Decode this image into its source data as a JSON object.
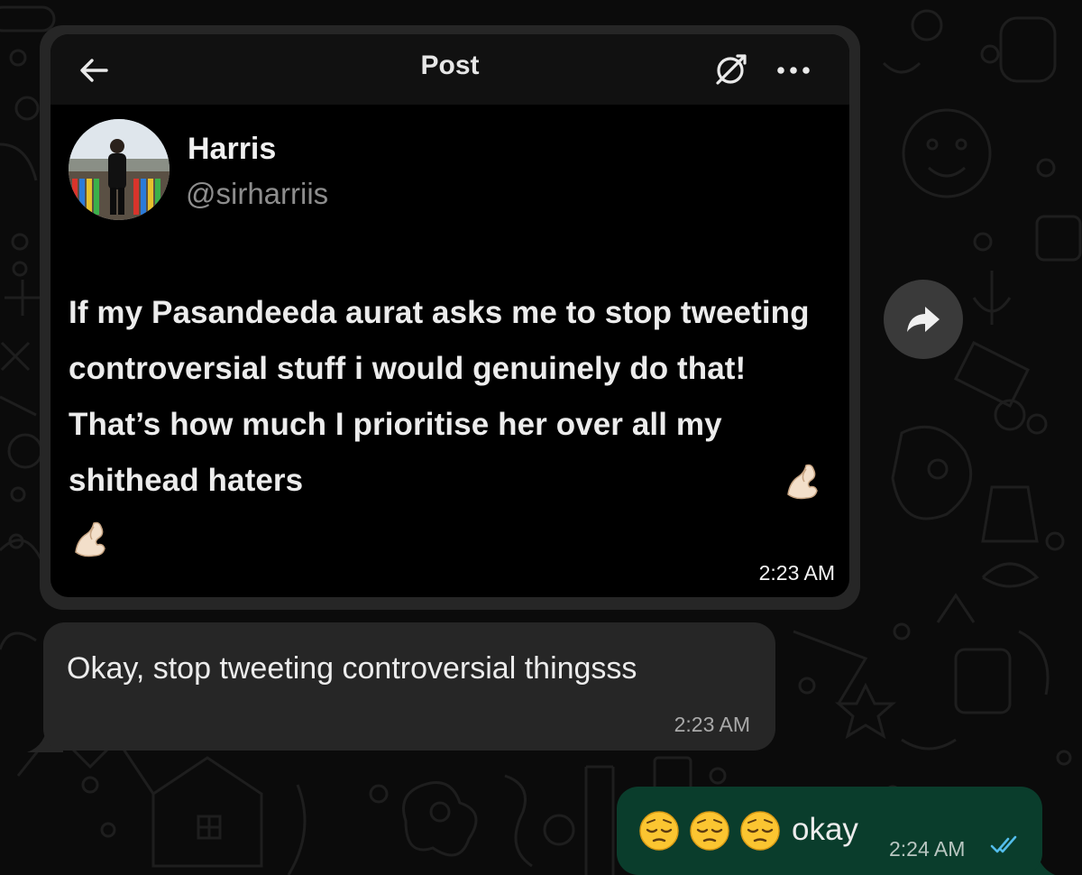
{
  "post": {
    "header_title": "Post",
    "back_icon": "arrow-left-icon",
    "noop_icon": "no-entry-slash-icon",
    "more_icon": "ellipsis-icon",
    "author_name": "Harris",
    "author_handle": "@sirharriis",
    "text": "If my Pasandeeda aurat asks me to stop tweeting controversial stuff i would genuinely do that! That’s how much I prioritise her over all my shithead haters",
    "text_emoji": "pinching-hand-icon",
    "time": "2:23 AM"
  },
  "forward_icon": "forward-arrow-icon",
  "messages": {
    "incoming": {
      "text": "Okay, stop tweeting controversial thingsss",
      "time": "2:23 AM"
    },
    "outgoing": {
      "emojis": [
        "pensive-face-icon",
        "pensive-face-icon",
        "pensive-face-icon"
      ],
      "text": "okay",
      "time": "2:24 AM",
      "status": "read"
    }
  },
  "colors": {
    "background": "#0b0b0b",
    "incoming_bubble": "#262626",
    "outgoing_bubble": "#0a3d2c",
    "read_tick": "#53bdeb"
  }
}
